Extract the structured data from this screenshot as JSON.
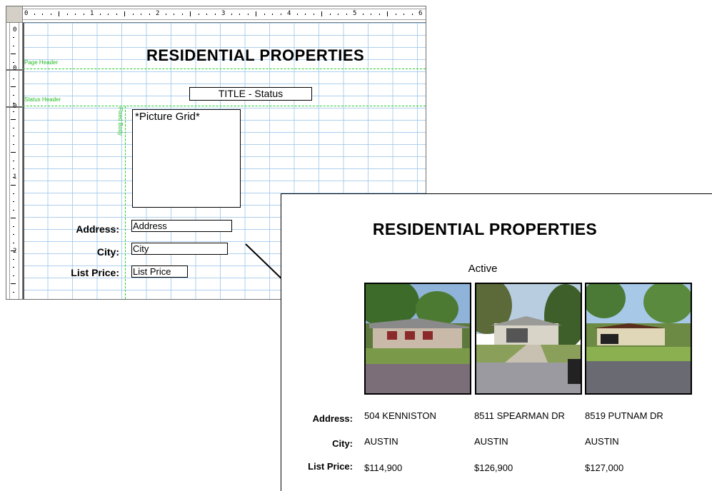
{
  "designer": {
    "ruler_top_numbers": [
      "0",
      "1",
      "2",
      "3",
      "4",
      "5",
      "6"
    ],
    "ruler_left_numbers": [
      "0",
      "0",
      "0",
      "1",
      "2"
    ],
    "band_labels": {
      "page_header": "Page Header",
      "status_header": "Status Header",
      "fixed_body": "Fixed Body"
    },
    "title": "RESIDENTIAL PROPERTIES",
    "status_box": "TITLE - Status",
    "picture_grid": "*Picture Grid*",
    "labels": {
      "address": "Address:",
      "city": "City:",
      "list_price": "List Price:"
    },
    "fields": {
      "address": "Address",
      "city": "City",
      "list_price": "List Price"
    }
  },
  "preview": {
    "title": "RESIDENTIAL PROPERTIES",
    "status": "Active",
    "labels": {
      "address": "Address:",
      "city": "City:",
      "list_price": "List Price:"
    },
    "properties": [
      {
        "address": "504 KENNISTON",
        "city": "AUSTIN",
        "price": "$114,900"
      },
      {
        "address": "8511 SPEARMAN DR",
        "city": "AUSTIN",
        "price": "$126,900"
      },
      {
        "address": "8519 PUTNAM DR",
        "city": "AUSTIN",
        "price": "$127,000"
      }
    ]
  },
  "colors": {
    "band_line": "#22cc22",
    "grid": "#a0c8eb"
  }
}
